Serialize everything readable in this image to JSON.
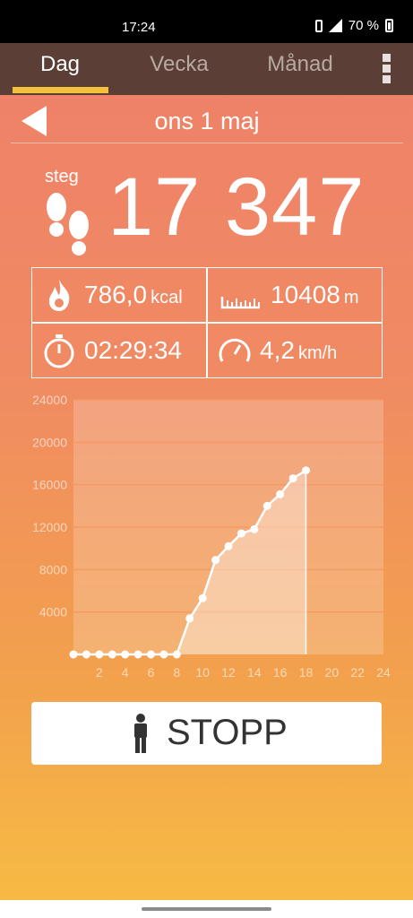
{
  "status_bar": {
    "time": "17:24",
    "battery": "70 %"
  },
  "tabs": [
    {
      "label": "Dag",
      "active": true
    },
    {
      "label": "Vecka",
      "active": false
    },
    {
      "label": "Månad",
      "active": false
    }
  ],
  "date": "ons 1 maj",
  "steps": {
    "unit": "steg",
    "value": "17 347"
  },
  "stats": {
    "calories": {
      "value": "786,0",
      "unit": "kcal"
    },
    "distance": {
      "value": "10408",
      "unit": "m"
    },
    "duration": {
      "value": "02:29:34"
    },
    "speed": {
      "value": "4,2",
      "unit": "km/h"
    }
  },
  "chart_data": {
    "type": "area",
    "x": [
      0,
      1,
      2,
      3,
      4,
      5,
      6,
      7,
      8,
      9,
      10,
      11,
      12,
      13,
      14,
      15,
      16,
      17,
      18
    ],
    "values": [
      0,
      0,
      0,
      0,
      0,
      0,
      0,
      0,
      0,
      3400,
      5300,
      8900,
      10200,
      11400,
      11800,
      14000,
      15100,
      16600,
      17347
    ],
    "xlim": [
      0,
      24
    ],
    "ylim": [
      0,
      24000
    ],
    "x_ticks": [
      2,
      4,
      6,
      8,
      10,
      12,
      14,
      16,
      18,
      20,
      22,
      24
    ],
    "y_ticks": [
      4000,
      8000,
      12000,
      16000,
      20000,
      24000
    ],
    "grid": true
  },
  "stop_button": {
    "label": "STOPP"
  },
  "colors": {
    "tab_bar": "#5b3f36",
    "tab_indicator": "#f5c03b",
    "accent_bg_top": "#ee7f69",
    "accent_bg_bottom": "#f7bd43"
  }
}
